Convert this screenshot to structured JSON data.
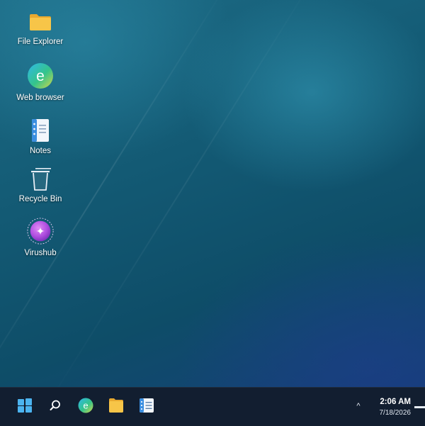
{
  "desktop": {
    "icons": [
      {
        "label": "File Explorer",
        "icon": "folder-icon"
      },
      {
        "label": "Web browser",
        "icon": "browser-icon",
        "glyph": "e"
      },
      {
        "label": "Notes",
        "icon": "notes-icon"
      },
      {
        "label": "Recycle Bin",
        "icon": "recycle-bin-icon"
      },
      {
        "label": "Virushub",
        "icon": "virushub-icon",
        "glyph": "✦"
      }
    ]
  },
  "taskbar": {
    "pinned": [
      {
        "name": "start",
        "icon": "windows-logo-icon"
      },
      {
        "name": "search",
        "icon": "search-icon"
      },
      {
        "name": "browser",
        "icon": "browser-icon",
        "glyph": "e"
      },
      {
        "name": "file-explorer",
        "icon": "folder-icon"
      },
      {
        "name": "notes",
        "icon": "notes-icon"
      }
    ],
    "tray": {
      "chevron": "^",
      "time": "2:06 AM",
      "date": "7/18/2026"
    }
  },
  "colors": {
    "taskbar_bg": "#121e30",
    "folder_yellow": "#f7c548",
    "virushub_purple": "#b04fe0",
    "notes_blue": "#3a8ee0"
  }
}
